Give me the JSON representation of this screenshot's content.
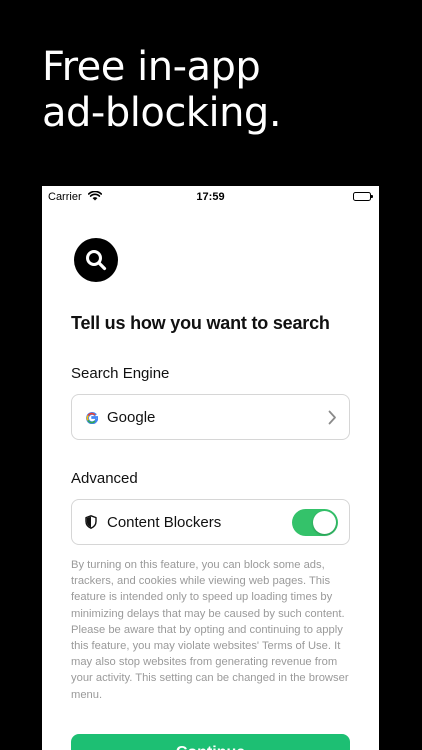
{
  "headline": {
    "line1": "Free in-app",
    "line2": "ad-blocking."
  },
  "status_bar": {
    "carrier": "Carrier",
    "time": "17:59"
  },
  "page": {
    "title": "Tell us how you want to search"
  },
  "search_engine": {
    "label": "Search Engine",
    "value": "Google"
  },
  "advanced": {
    "label": "Advanced",
    "content_blockers_label": "Content Blockers",
    "content_blockers_enabled": true
  },
  "description": "By turning on this feature, you can block some ads, trackers, and cookies while viewing web pages. This feature is intended only to speed up loading times by minimizing delays that may be caused by such content. Please be aware that by opting and continuing to apply this feature, you may violate websites' Terms of Use. It may also stop websites from generating revenue from your activity. This setting can be changed in the browser menu.",
  "cta": {
    "label": "Continue"
  },
  "colors": {
    "accent": "#1dbf73",
    "toggle_on": "#34c26a"
  }
}
